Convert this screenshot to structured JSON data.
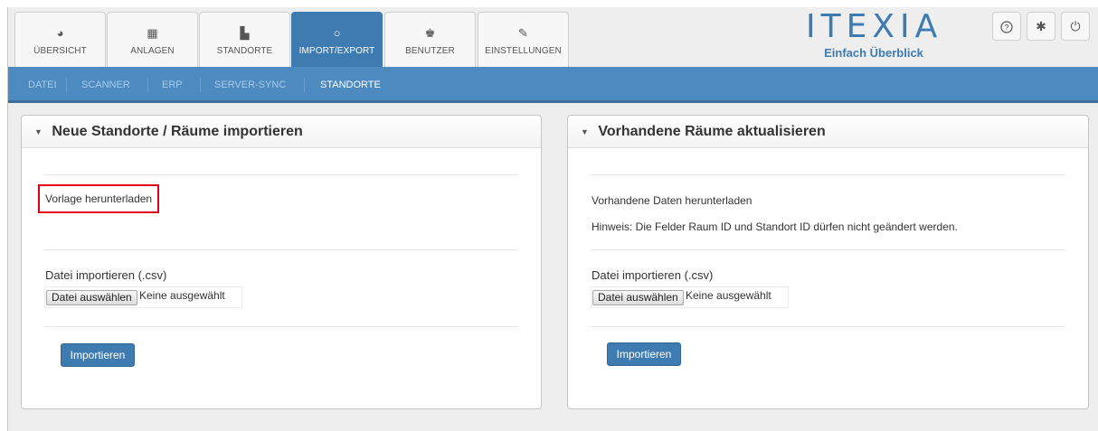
{
  "main_tabs": [
    {
      "label": "ÜBERSICHT",
      "icon": "pie-chart-icon",
      "glyph": "◕",
      "active": false
    },
    {
      "label": "ANLAGEN",
      "icon": "grid-table-icon",
      "glyph": "▦",
      "active": false
    },
    {
      "label": "STANDORTE",
      "icon": "building-icon",
      "glyph": "▙",
      "active": false
    },
    {
      "label": "IMPORT/EXPORT",
      "icon": "refresh-icon",
      "glyph": "○",
      "active": true
    },
    {
      "label": "BENUTZER",
      "icon": "user-icon",
      "glyph": "♚",
      "active": false
    },
    {
      "label": "EINSTELLUNGEN",
      "icon": "wrench-icon",
      "glyph": "✎",
      "active": false
    }
  ],
  "logo": {
    "word": "ITEXIA",
    "tagline": "Einfach Überblick"
  },
  "header_icons": [
    {
      "name": "help-icon",
      "glyph": "?"
    },
    {
      "name": "gear-icon",
      "glyph": "✱"
    },
    {
      "name": "power-icon",
      "glyph": "⏻"
    }
  ],
  "sub_nav": [
    {
      "label": "DATEI",
      "active": false
    },
    {
      "label": "SCANNER",
      "active": false
    },
    {
      "label": "ERP",
      "active": false
    },
    {
      "label": "SERVER-SYNC",
      "active": false
    },
    {
      "label": "STANDORTE",
      "active": true
    }
  ],
  "panel_left": {
    "title": "Neue Standorte / Räume importieren",
    "download_link": "Vorlage herunterladen",
    "file_label": "Datei importieren (.csv)",
    "file_button": "Datei auswählen",
    "file_status": "Keine ausgewählt",
    "import_button": "Importieren"
  },
  "panel_right": {
    "title": "Vorhandene Räume aktualisieren",
    "download_link": "Vorhandene Daten herunterladen",
    "hint": "Hinweis: Die Felder Raum ID und Standort ID dürfen nicht geändert werden.",
    "file_label": "Datei importieren (.csv)",
    "file_button": "Datei auswählen",
    "file_status": "Keine ausgewählt",
    "import_button": "Importieren"
  },
  "colors": {
    "accent": "#3e7bb1",
    "subnav": "#4d8ac0",
    "highlight": "#e3001b"
  }
}
